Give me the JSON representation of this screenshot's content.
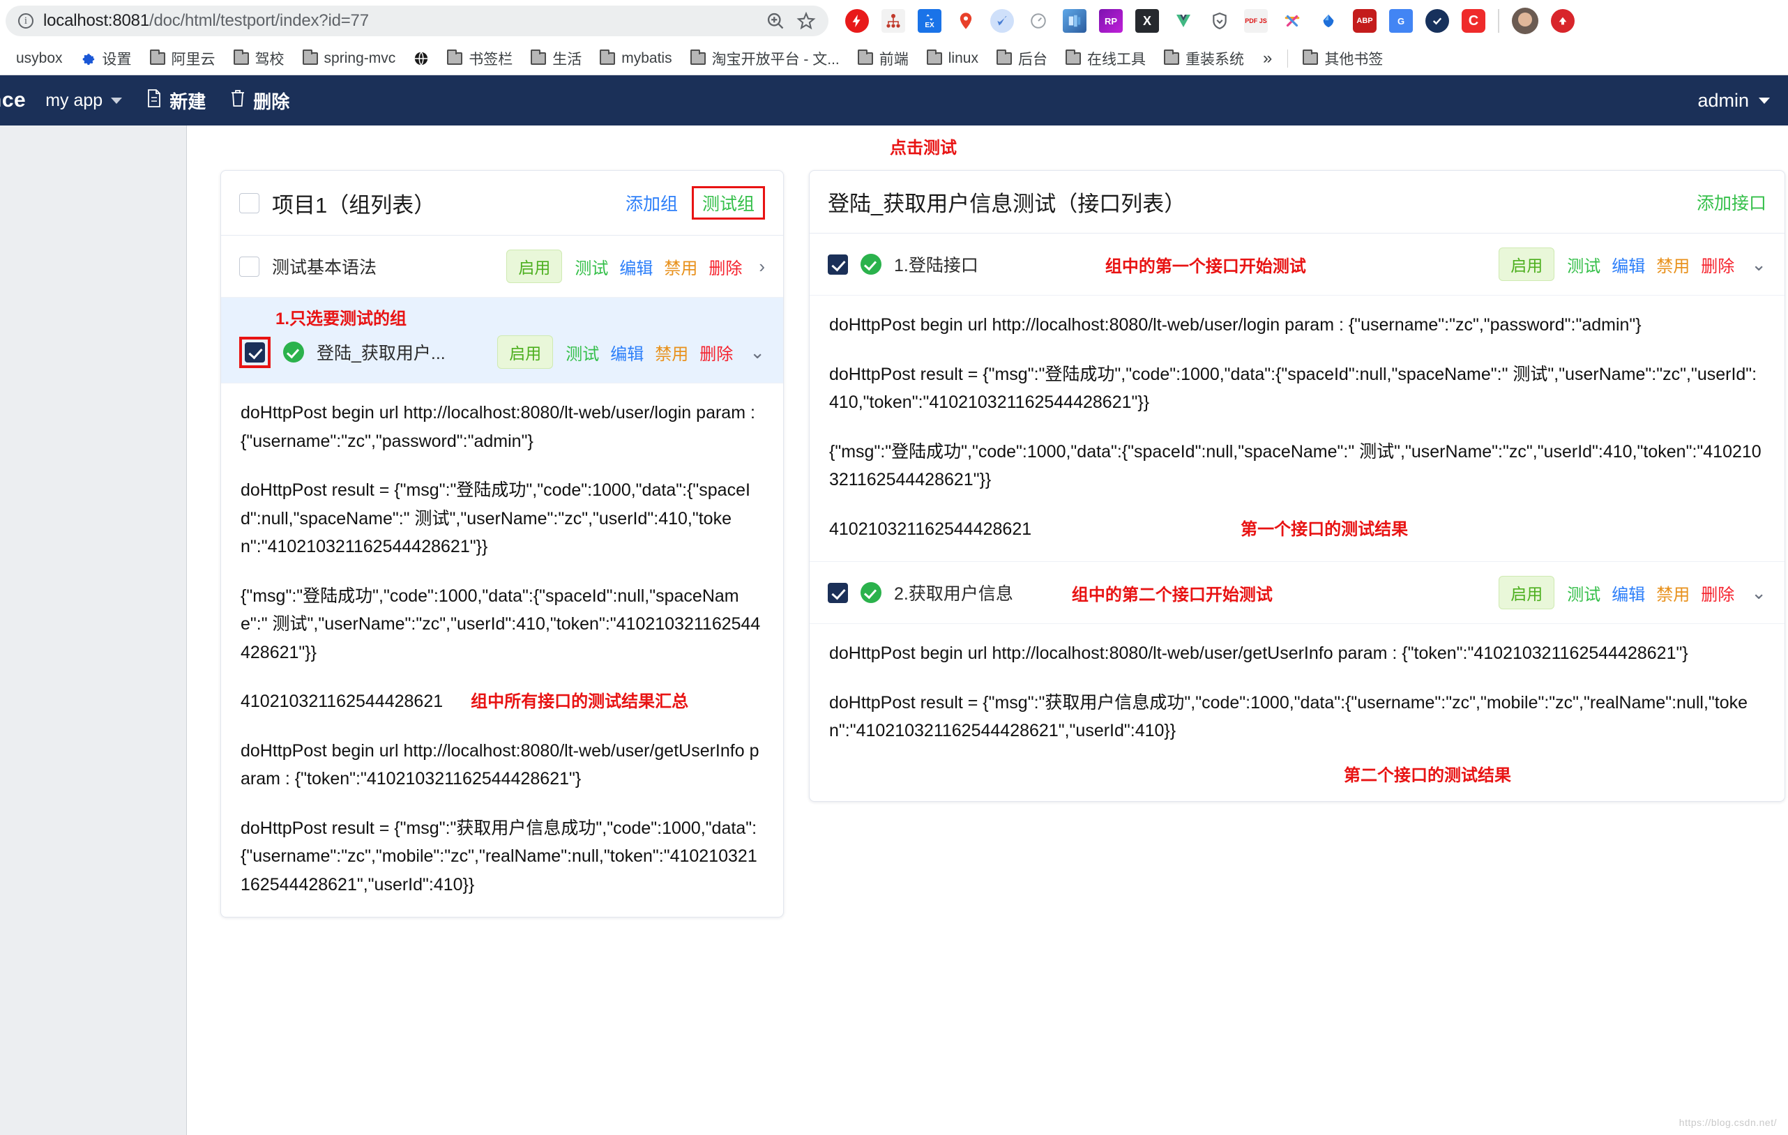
{
  "browser": {
    "url_main": "localhost:8081",
    "url_path": "/doc/html/testport/index?id=77",
    "info_icon": "info-icon",
    "zoom_icon": "zoom-icon",
    "star_icon": "star-icon",
    "extensions": [
      {
        "name": "extension-flash-block",
        "glyph": ""
      },
      {
        "name": "extension-sitemap",
        "glyph": ""
      },
      {
        "name": "extension-ex-transfer",
        "glyph": "EX"
      },
      {
        "name": "extension-location-pin",
        "glyph": ""
      },
      {
        "name": "extension-bird",
        "glyph": ""
      },
      {
        "name": "extension-speed-gauge",
        "glyph": ""
      },
      {
        "name": "extension-screenshot",
        "glyph": ""
      },
      {
        "name": "extension-rp",
        "glyph": "RP"
      },
      {
        "name": "extension-x",
        "glyph": "X"
      },
      {
        "name": "extension-vue-devtools",
        "glyph": "V"
      },
      {
        "name": "extension-shield-down",
        "glyph": ""
      },
      {
        "name": "extension-pdfjs",
        "glyph": "PDF JS"
      },
      {
        "name": "extension-colorful-star",
        "glyph": ""
      },
      {
        "name": "extension-blue-drop",
        "glyph": ""
      },
      {
        "name": "extension-adblock-plus",
        "glyph": "ABP"
      },
      {
        "name": "extension-google-translate",
        "glyph": "G"
      },
      {
        "name": "extension-check-circle",
        "glyph": ""
      },
      {
        "name": "extension-c-red",
        "glyph": "C"
      }
    ],
    "profile_avatar": "avatar",
    "update_button": "browser-update-button"
  },
  "bookmarks": {
    "items": [
      {
        "label": "usybox",
        "icon": "none"
      },
      {
        "label": "设置",
        "icon": "gear-icon"
      },
      {
        "label": "阿里云",
        "icon": "folder-icon"
      },
      {
        "label": "驾校",
        "icon": "folder-icon"
      },
      {
        "label": "spring-mvc",
        "icon": "folder-icon"
      },
      {
        "label": "",
        "icon": "globe-icon"
      },
      {
        "label": "书签栏",
        "icon": "folder-icon"
      },
      {
        "label": "生活",
        "icon": "folder-icon"
      },
      {
        "label": "mybatis",
        "icon": "folder-icon"
      },
      {
        "label": "淘宝开放平台 - 文...",
        "icon": "folder-icon"
      },
      {
        "label": "前端",
        "icon": "folder-icon"
      },
      {
        "label": "linux",
        "icon": "folder-icon"
      },
      {
        "label": "后台",
        "icon": "folder-icon"
      },
      {
        "label": "在线工具",
        "icon": "folder-icon"
      },
      {
        "label": "重装系统",
        "icon": "folder-icon"
      }
    ],
    "overflow_label": "»",
    "other_bookmarks": {
      "label": "其他书签",
      "icon": "folder-icon"
    }
  },
  "navbar": {
    "brand": "nce",
    "app_selector": "my app",
    "create_label": "新建",
    "delete_label": "删除",
    "create_icon": "document-icon",
    "delete_icon": "trash-icon",
    "user": "admin"
  },
  "annotations": {
    "click_test": "点击测试",
    "select_group_only": "1.只选要测试的组",
    "group_all_results": "组中所有接口的测试结果汇总",
    "first_api_start": "组中的第一个接口开始测试",
    "first_api_result": "第一个接口的测试结果",
    "second_api_start": "组中的第二个接口开始测试",
    "second_api_result": "第二个接口的测试结果"
  },
  "left_panel": {
    "title": "项目1（组列表）",
    "header_checkbox_checked": false,
    "add_group_label": "添加组",
    "test_group_label": "测试组",
    "rows": [
      {
        "name": "测试基本语法",
        "checked": false,
        "has_status_dot": false,
        "status_label": "启用",
        "actions": [
          "测试",
          "编辑",
          "禁用",
          "删除"
        ],
        "chevron": "›",
        "highlight": false
      },
      {
        "name": "登陆_获取用户...",
        "checked": true,
        "has_status_dot": true,
        "status_label": "启用",
        "actions": [
          "测试",
          "编辑",
          "禁用",
          "删除"
        ],
        "chevron": "⌄",
        "highlight": true
      }
    ],
    "logs": [
      "doHttpPost begin url http://localhost:8080/lt-web/user/login param : {\"username\":\"zc\",\"password\":\"admin\"}",
      "doHttpPost result = {\"msg\":\"登陆成功\",\"code\":1000,\"data\":{\"spaceId\":null,\"spaceName\":\" 测试\",\"userName\":\"zc\",\"userId\":410,\"token\":\"410210321162544428621\"}}",
      "{\"msg\":\"登陆成功\",\"code\":1000,\"data\":{\"spaceId\":null,\"spaceName\":\" 测试\",\"userName\":\"zc\",\"userId\":410,\"token\":\"410210321162544428621\"}}",
      "410210321162544428621",
      "doHttpPost begin url http://localhost:8080/lt-web/user/getUserInfo param : {\"token\":\"410210321162544428621\"}",
      "doHttpPost result = {\"msg\":\"获取用户信息成功\",\"code\":1000,\"data\":{\"username\":\"zc\",\"mobile\":\"zc\",\"realName\":null,\"token\":\"410210321162544428621\",\"userId\":410}}"
    ]
  },
  "right_panel": {
    "title": "登陆_获取用户信息测试（接口列表）",
    "add_api_label": "添加接口",
    "apis": [
      {
        "name": "1.登陆接口",
        "checked": true,
        "status_label": "启用",
        "actions": [
          "测试",
          "编辑",
          "禁用",
          "删除"
        ],
        "chevron": "⌄",
        "logs": [
          "doHttpPost begin url http://localhost:8080/lt-web/user/login param : {\"username\":\"zc\",\"password\":\"admin\"}",
          "doHttpPost result = {\"msg\":\"登陆成功\",\"code\":1000,\"data\":{\"spaceId\":null,\"spaceName\":\" 测试\",\"userName\":\"zc\",\"userId\":410,\"token\":\"410210321162544428621\"}}",
          "{\"msg\":\"登陆成功\",\"code\":1000,\"data\":{\"spaceId\":null,\"spaceName\":\" 测试\",\"userName\":\"zc\",\"userId\":410,\"token\":\"410210321162544428621\"}}",
          "410210321162544428621"
        ]
      },
      {
        "name": "2.获取用户信息",
        "checked": true,
        "status_label": "启用",
        "actions": [
          "测试",
          "编辑",
          "禁用",
          "删除"
        ],
        "chevron": "⌄",
        "logs": [
          "doHttpPost begin url http://localhost:8080/lt-web/user/getUserInfo param : {\"token\":\"410210321162544428621\"}",
          "doHttpPost result = {\"msg\":\"获取用户信息成功\",\"code\":1000,\"data\":{\"username\":\"zc\",\"mobile\":\"zc\",\"realName\":null,\"token\":\"410210321162544428621\",\"userId\":410}}"
        ]
      }
    ]
  },
  "watermark": "https://blog.csdn.net/",
  "colors": {
    "navbar": "#1b3058",
    "accent_blue": "#2d7ff9",
    "green": "#34bf49",
    "orange": "#e8911c",
    "red": "#f5222d",
    "annotation_red": "#e81313",
    "highlight_row": "#e8f2fe"
  }
}
